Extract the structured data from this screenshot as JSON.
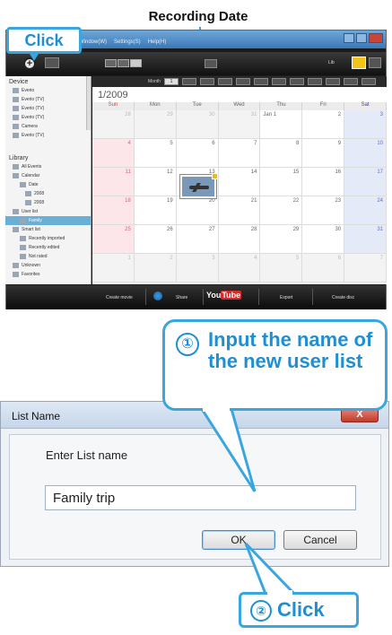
{
  "annotation": {
    "recording_date_label": "Recording Date",
    "click_top_label": "Click",
    "step1_number": "①",
    "step1_text": "Input the name of the new user list",
    "step2_number": "②",
    "step2_text": "Click",
    "accent_color": "#1f8fd3"
  },
  "app": {
    "menu": [
      "Window(W)",
      "Settings(S)",
      "Help(H)"
    ],
    "toolbar": {
      "add_icon": "plus-icon",
      "right_text": "Lib"
    },
    "sidebar": {
      "device_heading": "Device",
      "device_items": [
        "Everio",
        "Everio (TV)",
        "Everio (TV)",
        "Everio (TV)",
        "Camera",
        "Everio (TV)"
      ],
      "library_heading": "Library",
      "library_items": [
        "All Events",
        "Calendar",
        "Date",
        "2008",
        "2008",
        "User list",
        "Family",
        "Smart list",
        "Recently imported",
        "Recently edited",
        "Not rated",
        "Unknown",
        "Favorites"
      ]
    },
    "calendar": {
      "month_label": "Month",
      "month_active": "1",
      "title": "1/2009",
      "weekdays": [
        "Sun",
        "Mon",
        "Tue",
        "Wed",
        "Thu",
        "Fri",
        "Sat"
      ],
      "rows": [
        [
          "28",
          "29",
          "30",
          "31",
          "Jan 1",
          "2",
          "3"
        ],
        [
          "4",
          "5",
          "6",
          "7",
          "8",
          "9",
          "10"
        ],
        [
          "11",
          "12",
          "13",
          "14",
          "15",
          "16",
          "17"
        ],
        [
          "18",
          "19",
          "20",
          "21",
          "22",
          "23",
          "24"
        ],
        [
          "25",
          "26",
          "27",
          "28",
          "29",
          "30",
          "31"
        ],
        [
          "1",
          "2",
          "3",
          "4",
          "5",
          "6",
          "7"
        ]
      ]
    },
    "bottombar": {
      "create_movie": "Create movie",
      "share": "Share",
      "youtube_you": "You",
      "youtube_tube": "Tube",
      "export": "Export",
      "create_disc": "Create disc"
    }
  },
  "dialog": {
    "title": "List Name",
    "close_label": "X",
    "prompt": "Enter List name",
    "input_value": "Family trip",
    "ok_label": "OK",
    "cancel_label": "Cancel"
  }
}
